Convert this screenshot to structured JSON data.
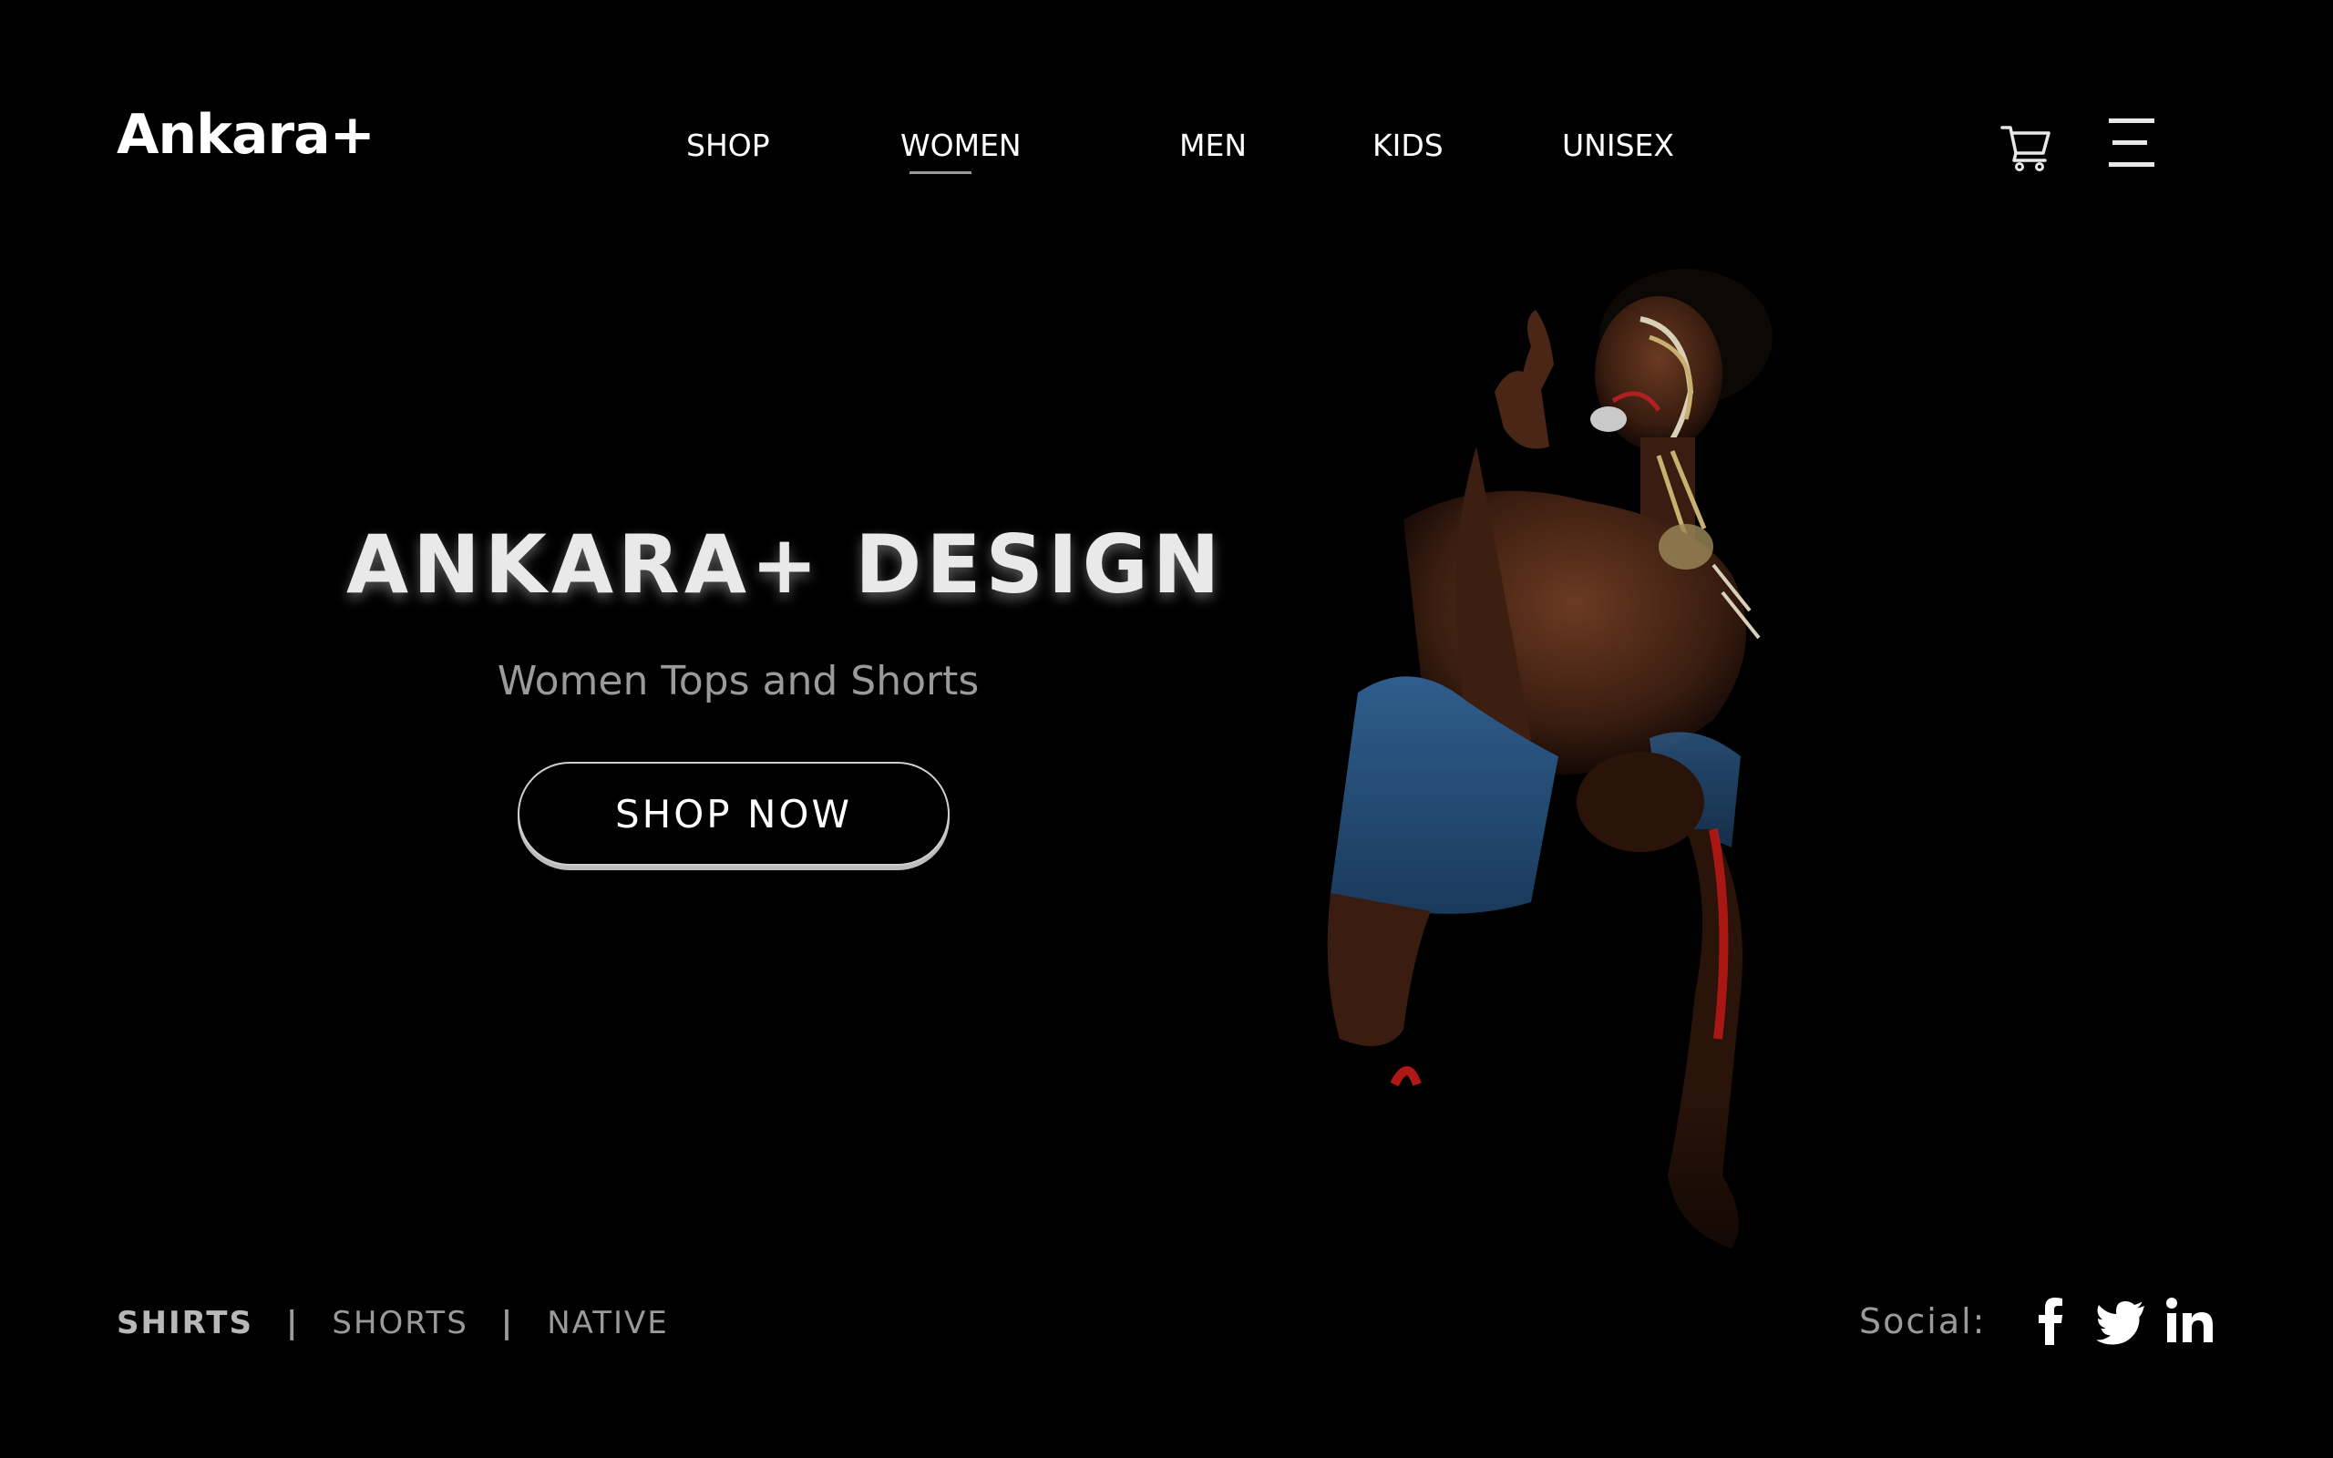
{
  "brand": {
    "logo": "Ankara+"
  },
  "nav": {
    "items": [
      {
        "label": "SHOP",
        "active": false
      },
      {
        "label": "WOMEN",
        "active": true
      },
      {
        "label": "MEN",
        "active": false
      },
      {
        "label": "KIDS",
        "active": false
      },
      {
        "label": "UNISEX",
        "active": false
      }
    ]
  },
  "header_icons": [
    "cart-icon",
    "hamburger-menu-icon"
  ],
  "hero": {
    "title": "ANKARA+ DESIGN",
    "subtitle": "Women Tops and Shorts",
    "cta_label": "SHOP NOW"
  },
  "categories": {
    "items": [
      {
        "label": "SHIRTS",
        "active": true
      },
      {
        "label": "SHORTS",
        "active": false
      },
      {
        "label": "NATIVE",
        "active": false
      }
    ],
    "separator": "|"
  },
  "social": {
    "label": "Social:",
    "icons": [
      "facebook-icon",
      "twitter-icon",
      "linkedin-icon"
    ]
  },
  "colors": {
    "background": "#000000",
    "text_primary": "#ffffff",
    "text_muted": "#9a9a9a",
    "underline": "#9a9a9a"
  }
}
